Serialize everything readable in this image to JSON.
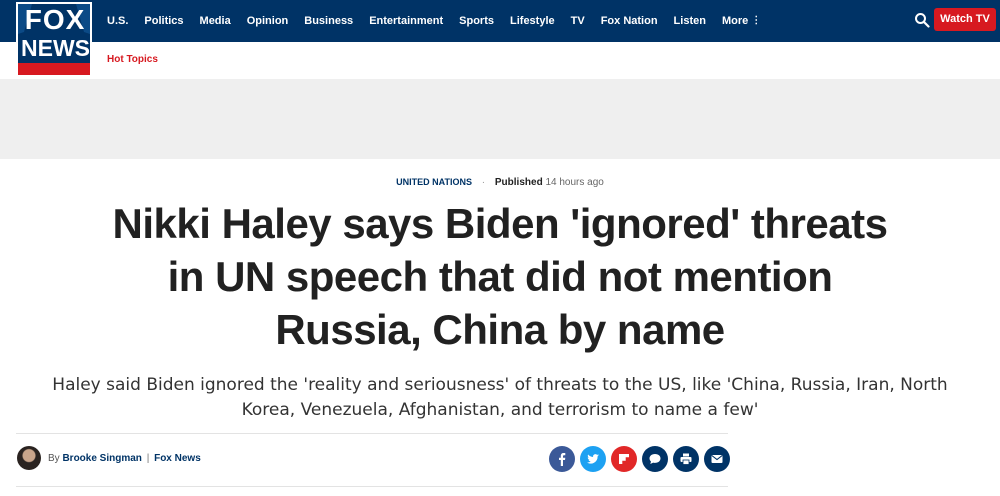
{
  "brand": {
    "logo_line1": "FOX",
    "logo_line2": "NEWS"
  },
  "nav": {
    "items": [
      "U.S.",
      "Politics",
      "Media",
      "Opinion",
      "Business",
      "Entertainment",
      "Sports",
      "Lifestyle",
      "TV",
      "Fox Nation",
      "Listen"
    ],
    "more_label": "More",
    "watch_label": "Watch TV",
    "search_icon": "search-icon"
  },
  "subnav": {
    "hot_topics": "Hot Topics"
  },
  "article": {
    "category": "UNITED NATIONS",
    "published_label": "Published",
    "published_time": "14 hours ago",
    "headline": "Nikki Haley says Biden 'ignored' threats in UN speech that did not mention Russia, China by name",
    "subhead": "Haley said Biden ignored the 'reality and seriousness' of threats to the US, like 'China, Russia, Iran, North Korea, Venezuela, Afghanistan, and terrorism to name a few'",
    "byline_prefix": "By",
    "author": "Brooke Singman",
    "separator": "|",
    "source": "Fox News"
  },
  "share_buttons": [
    {
      "name": "facebook-share-icon",
      "color": "#3b5998"
    },
    {
      "name": "twitter-share-icon",
      "color": "#1da1f2"
    },
    {
      "name": "flipboard-share-icon",
      "color": "#e12828"
    },
    {
      "name": "comments-icon",
      "color": "#003366"
    },
    {
      "name": "print-icon",
      "color": "#003366"
    },
    {
      "name": "email-icon",
      "color": "#003366"
    }
  ],
  "colors": {
    "navy": "#003366",
    "red": "#d71920",
    "ad_band": "#efefef"
  }
}
